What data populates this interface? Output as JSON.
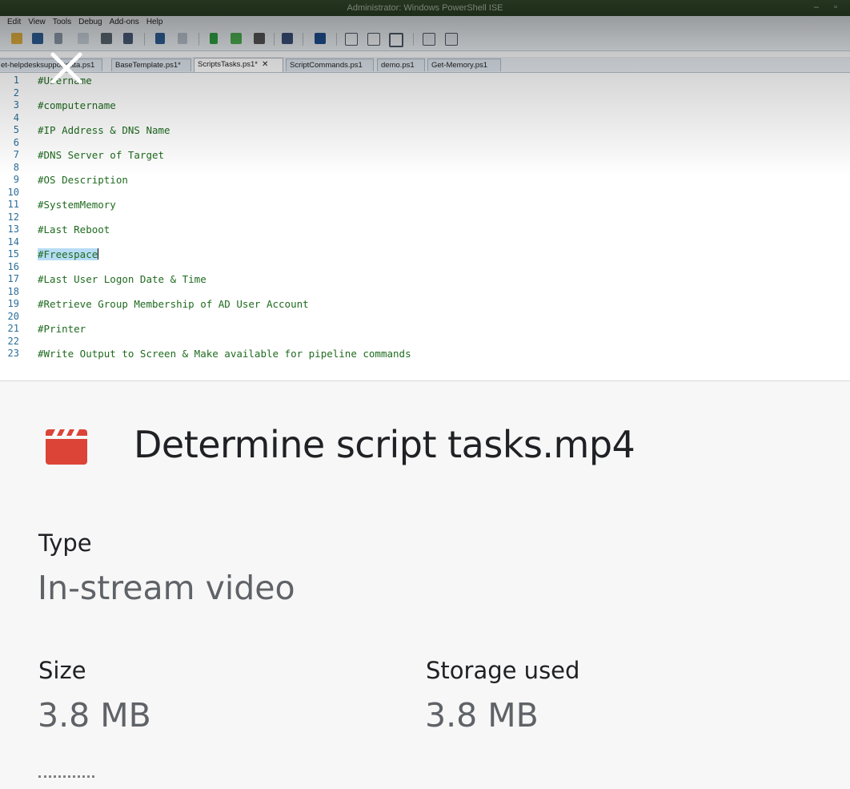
{
  "preview": {
    "window_title": "Administrator: Windows PowerShell ISE",
    "window_controls": "– ▫",
    "menu": [
      "Edit",
      "View",
      "Tools",
      "Debug",
      "Add-ons",
      "Help"
    ],
    "tabs": [
      {
        "label": "et-helpdesksupportdata.ps1",
        "active": false
      },
      {
        "label": "BaseTemplate.ps1*",
        "active": false
      },
      {
        "label": "ScriptsTasks.ps1*",
        "active": true,
        "close": "✕"
      },
      {
        "label": "ScriptCommands.ps1",
        "active": false
      },
      {
        "label": "demo.ps1",
        "active": false
      },
      {
        "label": "Get-Memory.ps1",
        "active": false
      }
    ],
    "line_numbers": [
      "1",
      "2",
      "3",
      "4",
      "5",
      "6",
      "7",
      "8",
      "9",
      "10",
      "11",
      "12",
      "13",
      "14",
      "15",
      "16",
      "17",
      "18",
      "19",
      "20",
      "21",
      "22",
      "23"
    ],
    "code_lines": [
      "#Username",
      "#computername",
      "#IP Address & DNS Name",
      "#DNS Server of Target",
      "#OS Description",
      "#SystemMemory",
      "#Last Reboot",
      "#Freespace",
      "#Last User Logon Date & Time",
      "#Retrieve Group Membership of AD User Account",
      "#Printer",
      "#Write Output to Screen & Make available for pipeline commands"
    ],
    "selected_line_index": 7,
    "colors": {
      "code": "#1f6b1f",
      "line_numbers": "#2b6f9a",
      "selection": "#b7dcf5",
      "titlebar": "#2c4427"
    }
  },
  "details": {
    "file_icon": "video-clapperboard-icon",
    "file_icon_color": "#db4437",
    "file_name": "Determine script tasks.mp4",
    "type_label": "Type",
    "type_value": "In-stream video",
    "size_label": "Size",
    "size_value": "3.8 MB",
    "storage_label": "Storage used",
    "storage_value": "3.8 MB"
  }
}
